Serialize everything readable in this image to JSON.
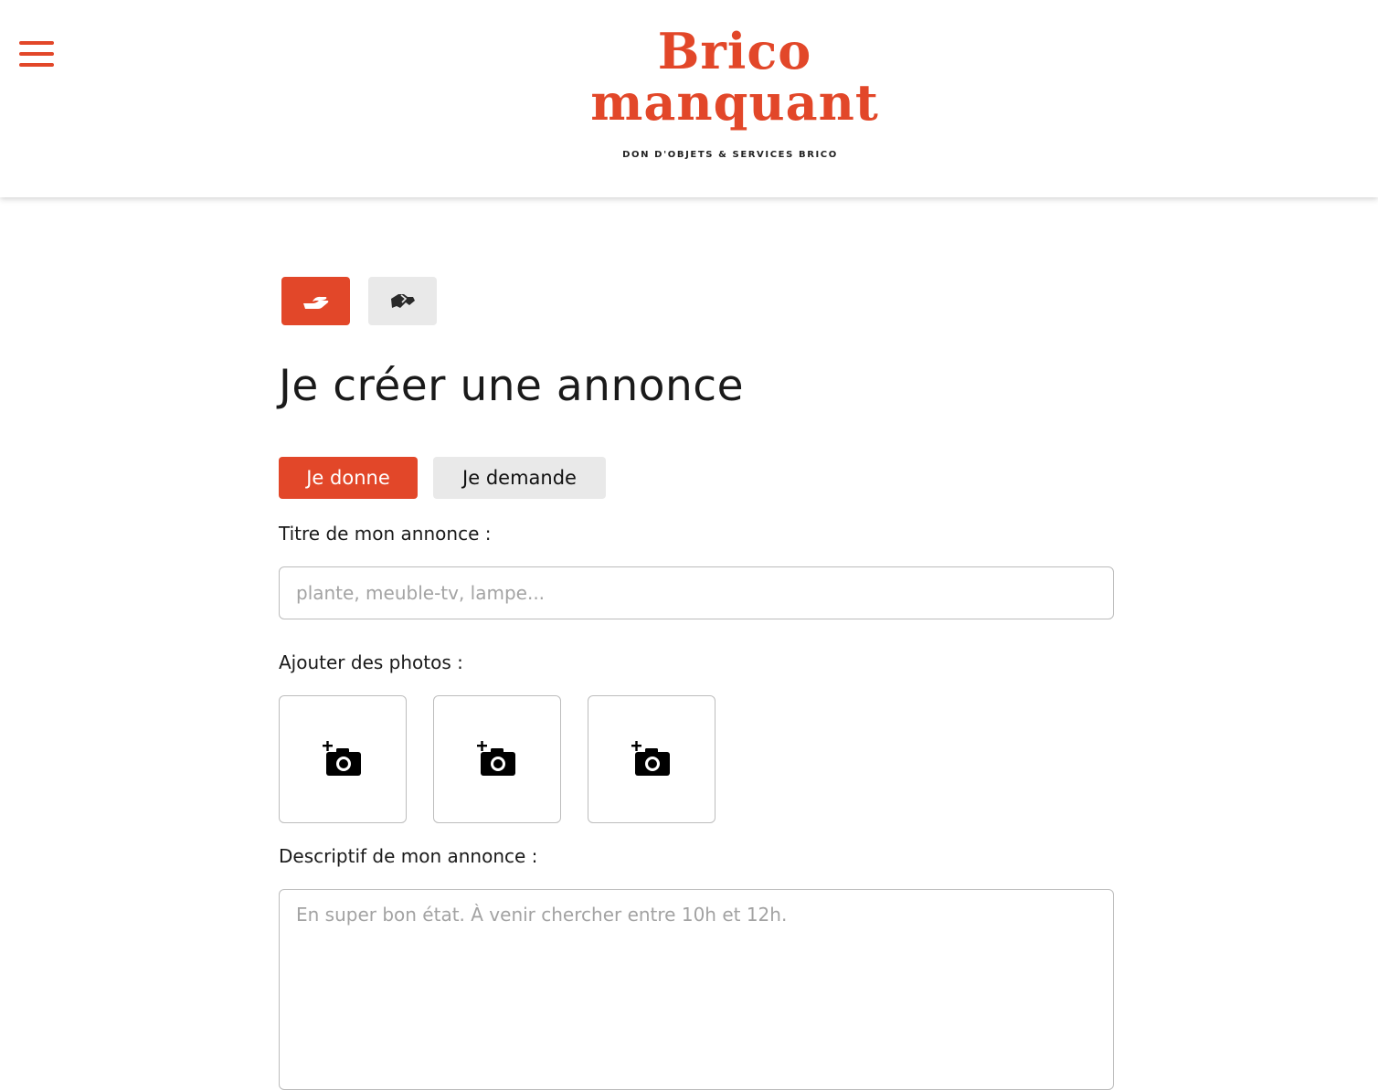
{
  "colors": {
    "accent": "#e24729",
    "neutral_button": "#e9e9e9",
    "text": "#1a1a1a",
    "placeholder": "#a3a3a3"
  },
  "header": {
    "menu_icon": "hamburger-menu-icon",
    "logo": {
      "line1": "Brico",
      "line2": "manquant",
      "tagline": "DON D'OBJETS & SERVICES BRICO"
    }
  },
  "mode_buttons": [
    {
      "icon": "giving-hand-icon",
      "active": true
    },
    {
      "icon": "handshake-icon",
      "active": false
    }
  ],
  "page_title": "Je créer une annonce",
  "ad_type_tabs": [
    {
      "label": "Je donne",
      "active": true
    },
    {
      "label": "Je demande",
      "active": false
    }
  ],
  "form": {
    "title_label": "Titre de mon annonce :",
    "title_placeholder": "plante, meuble-tv, lampe...",
    "title_value": "",
    "photos_label": "Ajouter des photos :",
    "photo_slots": [
      {
        "icon": "add-photo-icon"
      },
      {
        "icon": "add-photo-icon"
      },
      {
        "icon": "add-photo-icon"
      }
    ],
    "description_label": "Descriptif de mon annonce :",
    "description_placeholder": "En super bon état. À venir chercher entre 10h et 12h.",
    "description_value": ""
  }
}
